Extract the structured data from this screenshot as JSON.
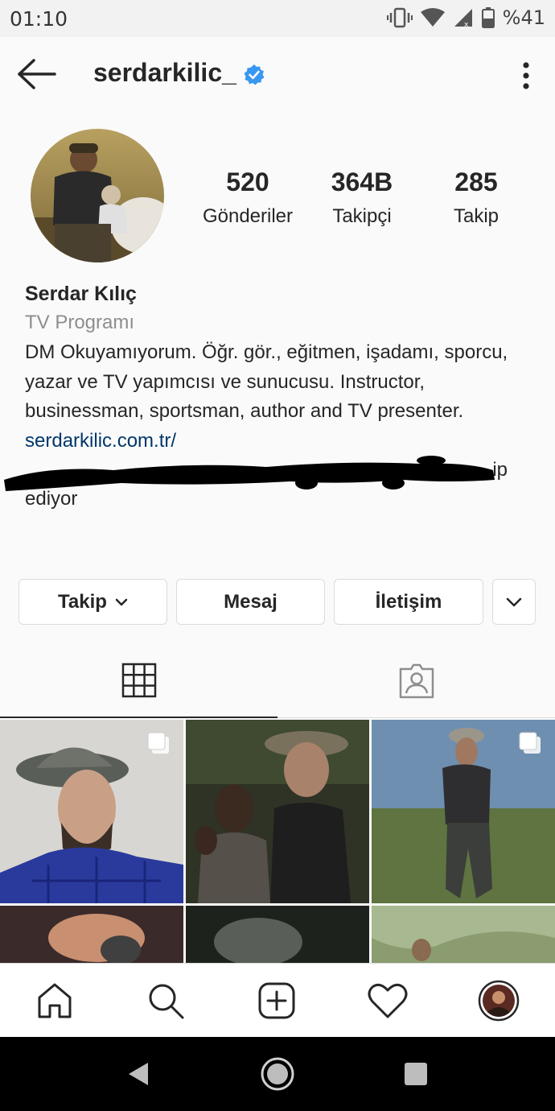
{
  "status_bar": {
    "time": "01:10",
    "battery": "%41"
  },
  "header": {
    "username": "serdarkilic_"
  },
  "stats": {
    "posts_value": "520",
    "posts_label": "Gönderiler",
    "followers_value": "364B",
    "followers_label": "Takipçi",
    "following_value": "285",
    "following_label": "Takip"
  },
  "bio": {
    "full_name": "Serdar Kılıç",
    "category": "TV Programı",
    "text": "DM Okuyamıyorum. Öğr. gör., eğitmen, işadamı, sporcu, yazar ve TV yapımcısı ve sunucusu. Instructor, businessman, sportsman, author and TV presenter.",
    "link": "serdarkilic.com.tr/",
    "followed_by_tail": "ip",
    "followed_by_end": "ediyor"
  },
  "actions": {
    "follow_label": "Takip",
    "message_label": "Mesaj",
    "contact_label": "İletişim"
  },
  "icons": {
    "back": "arrow-left-icon",
    "verified": "verified-badge-icon",
    "more": "more-vertical-icon",
    "grid_tab": "grid-icon",
    "tagged_tab": "tagged-person-icon",
    "home": "home-icon",
    "search": "search-icon",
    "new_post": "add-square-icon",
    "activity": "heart-icon",
    "profile": "profile-avatar-icon"
  },
  "colors": {
    "verified_blue": "#3897f0",
    "link_blue": "#00376b",
    "muted_text": "#8e8e8e"
  }
}
